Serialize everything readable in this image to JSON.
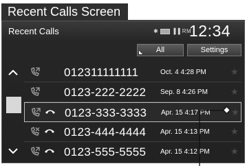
{
  "caption": "Recent Calls Screen",
  "header": {
    "title": "Recent Calls",
    "status_text": "RM",
    "clock": "12:34"
  },
  "tabs": [
    {
      "label": "All"
    },
    {
      "label": "Settings"
    }
  ],
  "calls": [
    {
      "number": "012311111111",
      "date": "Oct. 4 4:28 PM",
      "type": "outgoing",
      "phone_icon": false
    },
    {
      "number": "0123-222-2222",
      "date": "Sep. 8 4:26 PM",
      "type": "outgoing",
      "phone_icon": false
    },
    {
      "number": "0123-333-3333",
      "date": "Apr. 15 4:17 PM",
      "type": "outgoing",
      "phone_icon": true,
      "selected": true
    },
    {
      "number": "0123-444-4444",
      "date": "Apr. 15 4:13 PM",
      "type": "missed",
      "phone_icon": true
    },
    {
      "number": "0123-555-5555",
      "date": "Apr. 15 4:12 PM",
      "type": "outgoing",
      "phone_icon": true
    }
  ],
  "colors": {
    "screen_bg": "#222222",
    "text": "#ffffff",
    "dim_icon": "#8a8a8a"
  }
}
